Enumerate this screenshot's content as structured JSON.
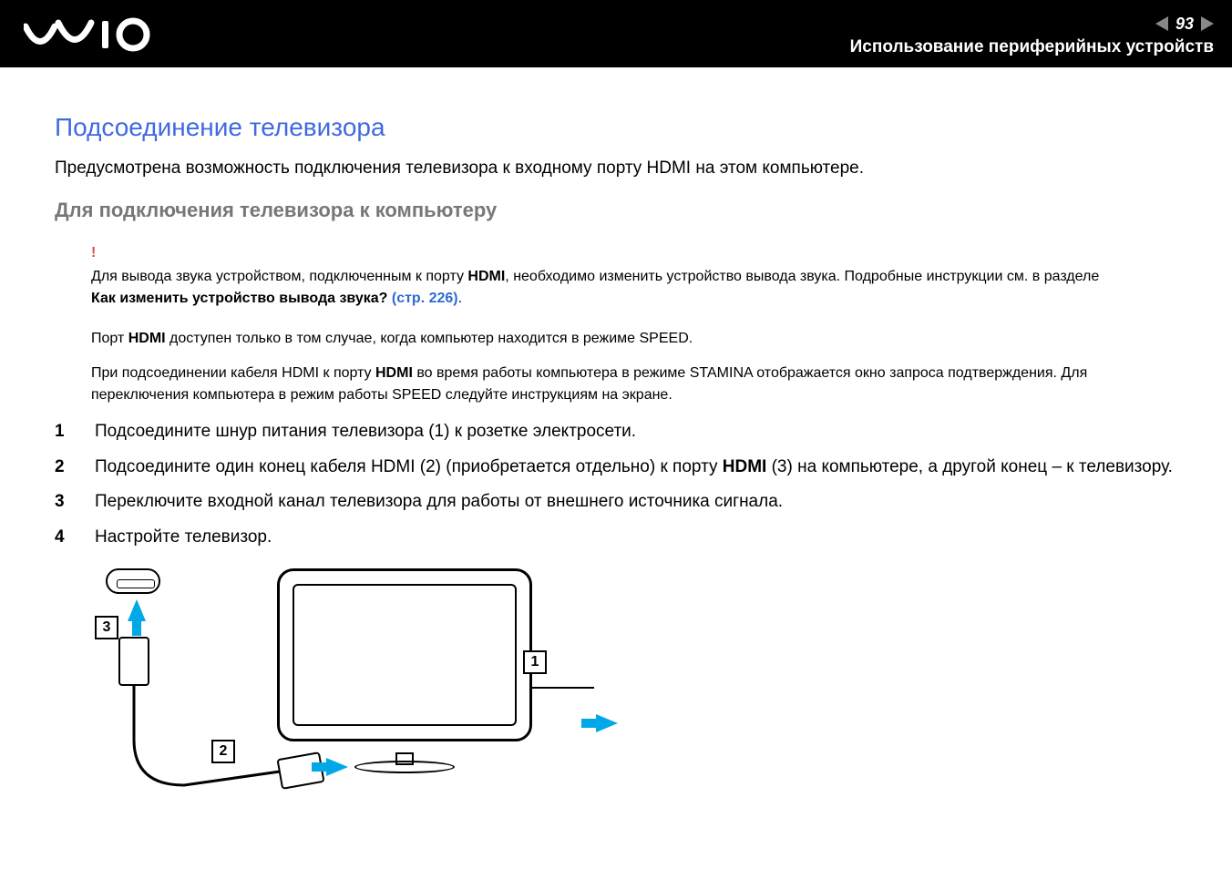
{
  "header": {
    "page_number": "93",
    "breadcrumb": "Использование периферийных устройств"
  },
  "content": {
    "title": "Подсоединение телевизора",
    "intro": "Предусмотрена возможность подключения телевизора к входному порту HDMI на этом компьютере.",
    "subheading": "Для подключения телевизора к компьютеру",
    "warning": {
      "pre": "Для вывода звука устройством, подключенным к порту ",
      "hdmi": "HDMI",
      "mid": ", необходимо изменить устройство вывода звука. Подробные инструкции см. в разделе ",
      "bold_q": "Как изменить устройство вывода звука? ",
      "link": "(стр. 226)",
      "dot": "."
    },
    "notes": {
      "n1_pre": "Порт ",
      "n1_b": "HDMI",
      "n1_post": " доступен только в том случае, когда компьютер находится в режиме SPEED.",
      "n2_pre": "При подсоединении кабеля HDMI к порту ",
      "n2_b": "HDMI",
      "n2_post": " во время работы компьютера в режиме STAMINA отображается окно запроса подтверждения. Для переключения компьютера в режим работы SPEED следуйте инструкциям на экране."
    },
    "steps": {
      "s1": "Подсоедините шнур питания телевизора (1) к розетке электросети.",
      "s2_pre": "Подсоедините один конец кабеля HDMI (2) (приобретается отдельно) к порту ",
      "s2_b": "HDMI",
      "s2_post": " (3) на компьютере, а другой конец – к телевизору.",
      "s3": "Переключите входной канал телевизора для работы от внешнего источника сигнала.",
      "s4": "Настройте телевизор."
    },
    "callouts": {
      "c1": "1",
      "c2": "2",
      "c3": "3"
    }
  }
}
